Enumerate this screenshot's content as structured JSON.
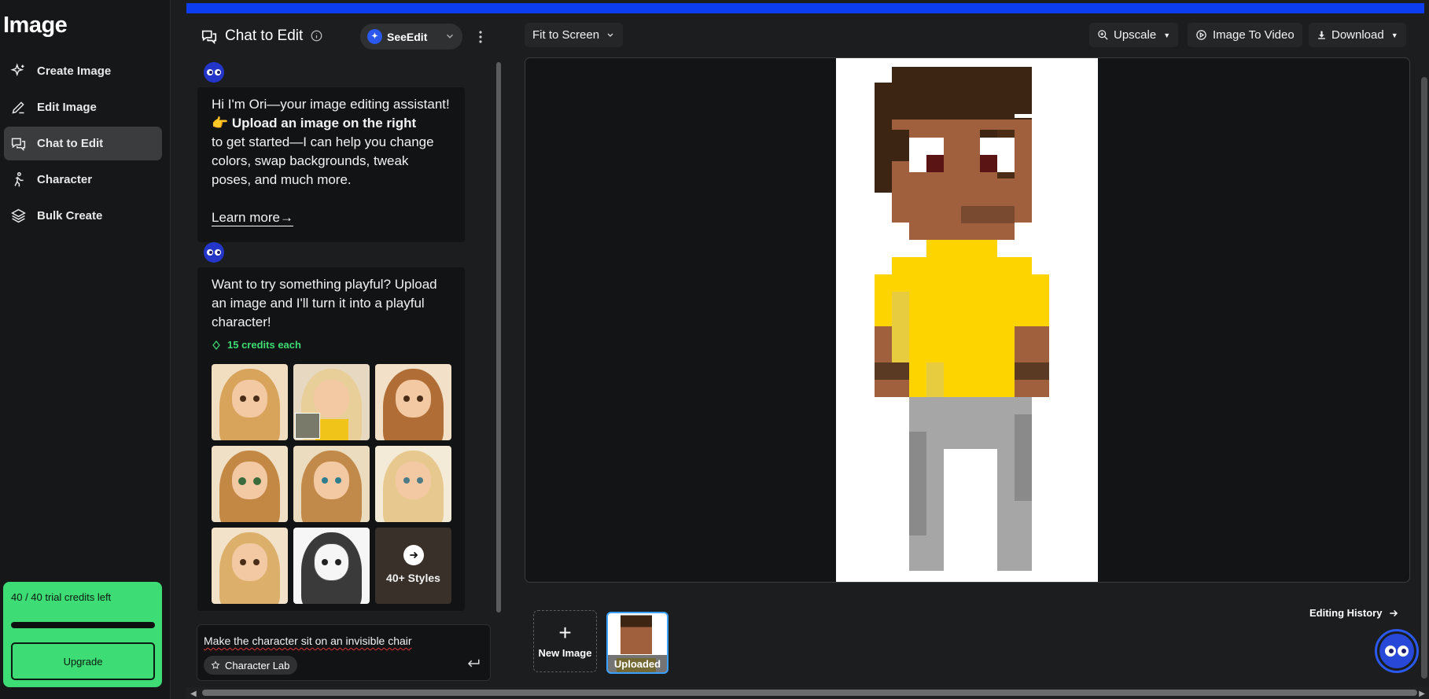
{
  "app": {
    "title": "Image"
  },
  "sidebar": {
    "items": [
      {
        "label": "Create Image",
        "icon": "sparkle-icon"
      },
      {
        "label": "Edit Image",
        "icon": "pencil-icon"
      },
      {
        "label": "Chat to Edit",
        "icon": "chat-icon",
        "active": true
      },
      {
        "label": "Character",
        "icon": "running-person-icon"
      },
      {
        "label": "Bulk Create",
        "icon": "layers-icon"
      }
    ],
    "credits": {
      "text": "40 / 40 trial credits left",
      "fraction": 1.0,
      "upgrade_label": "Upgrade"
    }
  },
  "chat": {
    "title": "Chat to Edit",
    "model": "SeeEdit",
    "messages": [
      {
        "line1": "Hi I'm Ori—your image editing assistant!",
        "emoji": "👉",
        "bold": "Upload an image on the right",
        "rest": "to get started—I can help you change colors, swap backgrounds, tweak poses, and much more.",
        "link": "Learn more"
      },
      {
        "text": "Want to try something playful? Upload an image and I'll turn it into a playful character!",
        "credits": "15 credits each",
        "more_styles": "40+ Styles"
      }
    ],
    "input": {
      "value": "Make the character sit on an invisible chair",
      "chip": "Character Lab"
    }
  },
  "toolbar": {
    "fit": "Fit to Screen",
    "upscale": "Upscale",
    "image_to_video": "Image To Video",
    "download": "Download"
  },
  "bottom": {
    "new_image": "New Image",
    "uploaded": "Uploaded",
    "history": "Editing History"
  },
  "colors": {
    "accent_blue": "#0d3df0",
    "credit_green": "#3ddc74"
  }
}
